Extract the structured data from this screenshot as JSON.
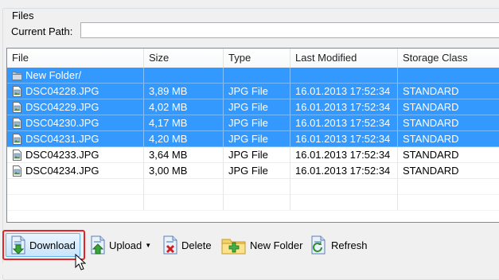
{
  "group": {
    "title": "Files"
  },
  "path": {
    "label": "Current Path:",
    "value": ""
  },
  "table": {
    "columns": [
      "File",
      "Size",
      "Type",
      "Last Modified",
      "Storage Class"
    ],
    "rows": [
      {
        "name": "New Folder/",
        "size": "",
        "type": "",
        "modified": "",
        "storage": "",
        "kind": "folder",
        "selected": true
      },
      {
        "name": "DSC04228.JPG",
        "size": "3,89 MB",
        "type": "JPG File",
        "modified": "16.01.2013 17:52:34",
        "storage": "STANDARD",
        "kind": "file",
        "selected": true
      },
      {
        "name": "DSC04229.JPG",
        "size": "4,02 MB",
        "type": "JPG File",
        "modified": "16.01.2013 17:52:34",
        "storage": "STANDARD",
        "kind": "file",
        "selected": true
      },
      {
        "name": "DSC04230.JPG",
        "size": "4,17 MB",
        "type": "JPG File",
        "modified": "16.01.2013 17:52:34",
        "storage": "STANDARD",
        "kind": "file",
        "selected": true
      },
      {
        "name": "DSC04231.JPG",
        "size": "4,20 MB",
        "type": "JPG File",
        "modified": "16.01.2013 17:52:34",
        "storage": "STANDARD",
        "kind": "file",
        "selected": true
      },
      {
        "name": "DSC04233.JPG",
        "size": "3,64 MB",
        "type": "JPG File",
        "modified": "16.01.2013 17:52:34",
        "storage": "STANDARD",
        "kind": "file",
        "selected": false
      },
      {
        "name": "DSC04234.JPG",
        "size": "3,00 MB",
        "type": "JPG File",
        "modified": "16.01.2013 17:52:34",
        "storage": "STANDARD",
        "kind": "file",
        "selected": false
      }
    ]
  },
  "toolbar": {
    "download": "Download",
    "upload": "Upload",
    "delete": "Delete",
    "new_folder": "New Folder",
    "refresh": "Refresh"
  },
  "colors": {
    "selection": "#3399ff",
    "highlight_border": "#e0262a"
  }
}
